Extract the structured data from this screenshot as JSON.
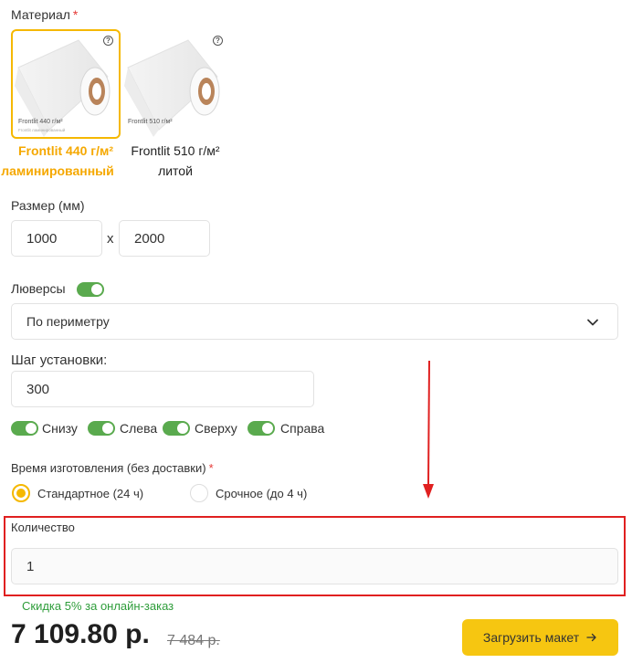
{
  "material": {
    "label": "Материал",
    "required_mark": "*",
    "options": [
      {
        "card_title": "Frontlit 440 г/м²",
        "card_subtitle": "Frontlit ламинированный",
        "name_line1": "Frontlit 440 г/м²",
        "name_line2": "ламинированный",
        "selected": true
      },
      {
        "card_title": "Frontlit 510 г/м²",
        "card_subtitle": "",
        "name_line1": "Frontlit 510 г/м²",
        "name_line2": "литой",
        "selected": false
      }
    ],
    "help_icon": "?"
  },
  "size": {
    "label": "Размер (мм)",
    "width": "1000",
    "separator": "x",
    "height": "2000"
  },
  "grommets": {
    "label": "Люверсы",
    "enabled": true,
    "placement": "По периметру",
    "step_label": "Шаг установки:",
    "step_value": "300",
    "sides": [
      {
        "label": "Снизу",
        "enabled": true
      },
      {
        "label": "Слева",
        "enabled": true
      },
      {
        "label": "Сверху",
        "enabled": true
      },
      {
        "label": "Справа",
        "enabled": true
      }
    ]
  },
  "production_time": {
    "label": "Время изготовления (без доставки)",
    "required_mark": "*",
    "options": [
      {
        "label": "Стандартное (24 ч)",
        "selected": true
      },
      {
        "label": "Срочное (до 4 ч)",
        "selected": false
      }
    ]
  },
  "quantity": {
    "label": "Количество",
    "value": "1"
  },
  "pricing": {
    "discount_text": "Скидка 5% за онлайн-заказ",
    "price": "7 109.80 р.",
    "old_price": "7 484 р."
  },
  "actions": {
    "upload_label": "Загрузить макет",
    "upload_icon": "arrow-right-icon"
  },
  "colors": {
    "accent": "#f5b800",
    "toggle_on": "#5aaa4e",
    "discount": "#2e9d3a",
    "annotation": "#e02020"
  }
}
